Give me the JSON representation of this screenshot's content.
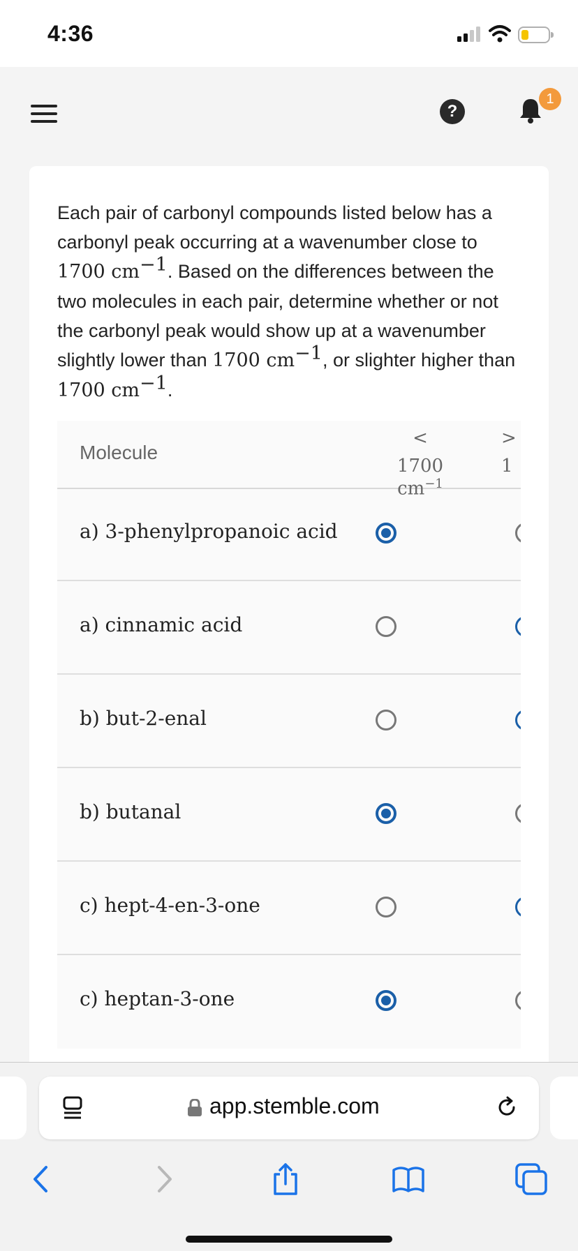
{
  "status_bar": {
    "time": "4:36"
  },
  "header": {
    "help_label": "?",
    "notification_count": "1"
  },
  "question": {
    "part1": "Each pair of carbonyl compounds listed below has a carbonyl peak occurring at a wavenumber close to ",
    "value": "1700 cm",
    "exp": "−1",
    "part2": ". Based on the differences between the two molecules in each pair, determine whether or not the carbonyl peak would show up at a wavenumber slightly lower than ",
    "part3": ", or slighter higher than ",
    "part4": "."
  },
  "table": {
    "col_molecule": "Molecule",
    "col_lower_symbol": "<",
    "col_lower_value": "1700 cm",
    "col_higher_symbol": ">",
    "col_higher_value": "1",
    "unit_exp": "−1",
    "rows": [
      {
        "label": "a) 3-phenylpropanoic acid",
        "selected": "lower"
      },
      {
        "label": "a) cinnamic acid",
        "selected": "higher"
      },
      {
        "label": "b) but-2-enal",
        "selected": "higher"
      },
      {
        "label": "b) butanal",
        "selected": "lower"
      },
      {
        "label": "c) hept-4-en-3-one",
        "selected": "higher"
      },
      {
        "label": "c) heptan-3-one",
        "selected": "lower"
      }
    ]
  },
  "browser": {
    "url": "app.stemble.com"
  },
  "colors": {
    "accent": "#1a5fa8",
    "badge": "#f39a3c",
    "battery": "#f5c400"
  }
}
